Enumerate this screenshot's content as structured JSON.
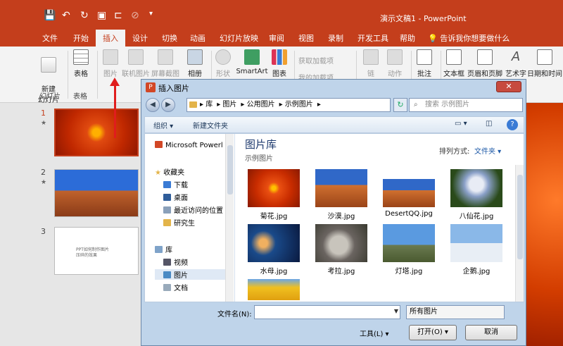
{
  "app": {
    "title": "演示文稿1 - PowerPoint",
    "tell_me": "告诉我你想要做什么"
  },
  "tabs": [
    "文件",
    "开始",
    "插入",
    "设计",
    "切换",
    "动画",
    "幻灯片放映",
    "审阅",
    "视图",
    "录制",
    "开发工具",
    "帮助"
  ],
  "ribbon": {
    "new_slide": "新建\n幻灯片",
    "group_slides": "幻灯片",
    "table": "表格",
    "group_table": "表格",
    "pictures": "图片",
    "online_pictures": "联机图片",
    "screenshot": "屏幕截图",
    "album": "相册",
    "shapes": "形状",
    "smartart": "SmartArt",
    "chart": "图表",
    "get_addins": "获取加载项",
    "my_addins": "我的加载项",
    "link": "链",
    "action": "动作",
    "comment": "批注",
    "textbox": "文本框",
    "header_footer": "页眉和页脚",
    "wordart": "艺术字",
    "datetime": "日期和时间"
  },
  "slides": [
    {
      "num": "1",
      "star": "★"
    },
    {
      "num": "2",
      "star": "★"
    },
    {
      "num": "3",
      "text": "PPT如何制作图片\n压碎的效果"
    }
  ],
  "dialog": {
    "title": "插入图片",
    "close": "✕",
    "path": [
      "库",
      "图片",
      "公用图片",
      "示例图片"
    ],
    "search_placeholder": "搜索 示例图片",
    "organize": "组织 ▾",
    "new_folder": "新建文件夹",
    "tree": {
      "microsoft": "Microsoft Powerl",
      "favorites": "收藏夹",
      "downloads": "下载",
      "desktop": "桌面",
      "recent": "最近访问的位置",
      "grad": "研究生",
      "library": "库",
      "videos": "视频",
      "pictures": "图片",
      "documents": "文档"
    },
    "lib_title": "图片库",
    "lib_sub": "示例图片",
    "sort_label": "排列方式:",
    "sort_value": "文件夹 ▾",
    "pictures": [
      {
        "label": "菊花.jpg"
      },
      {
        "label": "沙漠.jpg"
      },
      {
        "label": "DesertQQ.jpg"
      },
      {
        "label": "八仙花.jpg"
      },
      {
        "label": "水母.jpg"
      },
      {
        "label": "考拉.jpg"
      },
      {
        "label": "灯塔.jpg"
      },
      {
        "label": "企鹅.jpg"
      }
    ],
    "filename_label": "文件名(N):",
    "filetype": "所有图片",
    "tools": "工具(L)  ▾",
    "open": "打开(O)  ▾",
    "cancel": "取消"
  }
}
